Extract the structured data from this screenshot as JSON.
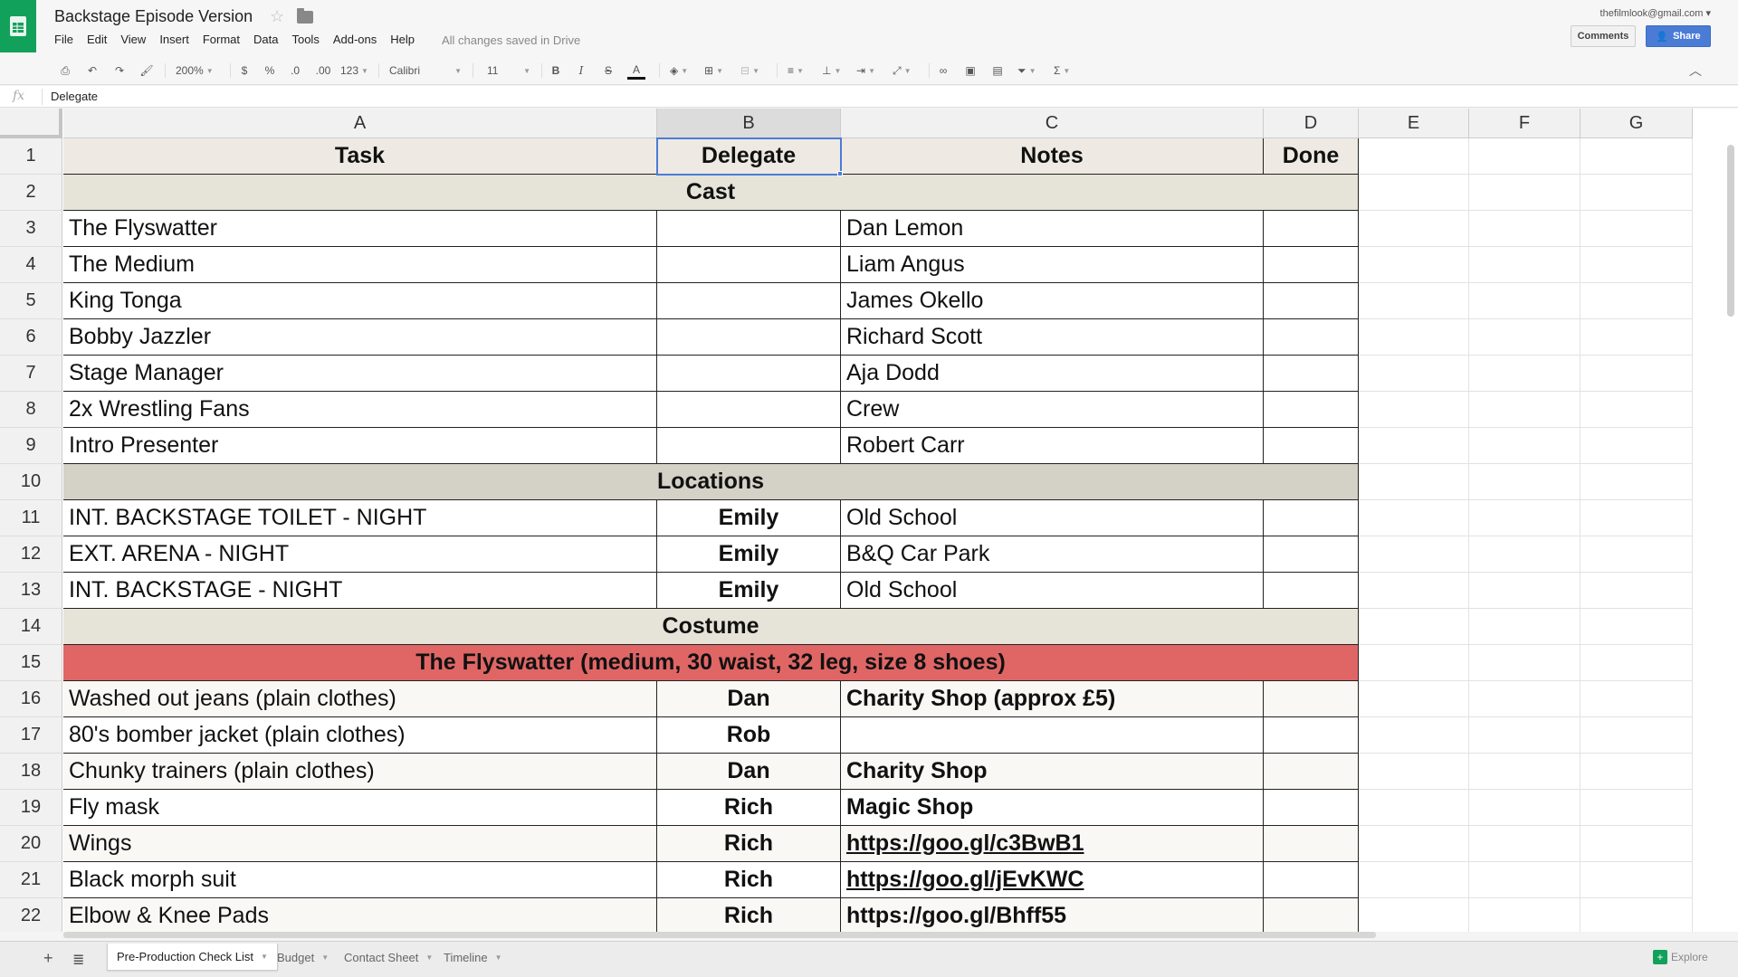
{
  "app": {
    "title": "Backstage Episode Version",
    "account": "thefilmlook@gmail.com",
    "saved_status": "All changes saved in Drive",
    "comments_label": "Comments",
    "share_label": "Share",
    "brand_color": "#12a15a",
    "accent_color": "#4a7cd6"
  },
  "menu": [
    "File",
    "Edit",
    "View",
    "Insert",
    "Format",
    "Data",
    "Tools",
    "Add-ons",
    "Help"
  ],
  "toolbar": {
    "zoom": "200%",
    "currency": "$",
    "percent": "%",
    "decrease_decimal": ".0",
    "increase_decimal": ".00",
    "number_format": "123",
    "font": "Calibri",
    "font_size": "11",
    "bold": "B",
    "italic": "I",
    "strike": "S",
    "text_color": "A",
    "icons": [
      "print-icon",
      "undo-icon",
      "redo-icon",
      "paint-format-icon",
      "fill-color-icon",
      "borders-icon",
      "merge-icon",
      "align-left-icon",
      "valign-icon",
      "wrap-icon",
      "rotate-icon",
      "link-icon",
      "comment-icon",
      "chart-icon",
      "filter-icon",
      "sigma-icon"
    ]
  },
  "formula": {
    "value": "Delegate"
  },
  "columns": [
    "A",
    "B",
    "C",
    "D",
    "E",
    "F",
    "G"
  ],
  "rows": [
    {
      "n": "1",
      "type": "header",
      "a": "Task",
      "b": "Delegate",
      "c": "Notes",
      "d": "Done"
    },
    {
      "n": "2",
      "type": "section",
      "label": "Cast"
    },
    {
      "n": "3",
      "type": "data",
      "a": "The Flyswatter",
      "b": "",
      "c": "Dan Lemon",
      "d": ""
    },
    {
      "n": "4",
      "type": "data",
      "a": "The Medium",
      "b": "",
      "c": "Liam Angus",
      "d": ""
    },
    {
      "n": "5",
      "type": "data",
      "a": "King Tonga",
      "b": "",
      "c": "James Okello",
      "d": ""
    },
    {
      "n": "6",
      "type": "data",
      "a": "Bobby Jazzler",
      "b": "",
      "c": "Richard Scott",
      "d": ""
    },
    {
      "n": "7",
      "type": "data",
      "a": "Stage Manager",
      "b": "",
      "c": "Aja Dodd",
      "d": ""
    },
    {
      "n": "8",
      "type": "data",
      "a": "2x Wrestling Fans",
      "b": "",
      "c": "Crew",
      "d": ""
    },
    {
      "n": "9",
      "type": "data",
      "a": "Intro Presenter",
      "b": "",
      "c": "Robert Carr",
      "d": ""
    },
    {
      "n": "10",
      "type": "section",
      "label": "Locations",
      "variant": "loc"
    },
    {
      "n": "11",
      "type": "data",
      "a": "INT. BACKSTAGE TOILET - NIGHT",
      "b": "Emily",
      "c": "Old School",
      "d": ""
    },
    {
      "n": "12",
      "type": "data",
      "a": "EXT. ARENA - NIGHT",
      "b": "Emily",
      "c": "B&Q Car Park",
      "d": ""
    },
    {
      "n": "13",
      "type": "data",
      "a": "INT. BACKSTAGE - NIGHT",
      "b": "Emily",
      "c": "Old School",
      "d": ""
    },
    {
      "n": "14",
      "type": "section",
      "label": "Costume"
    },
    {
      "n": "15",
      "type": "banner",
      "label": "The Flyswatter (medium, 30 waist, 32 leg, size 8 shoes)"
    },
    {
      "n": "16",
      "type": "data",
      "tint": true,
      "a": "Washed out jeans (plain clothes)",
      "b": "Dan",
      "c": "Charity Shop (approx £5)",
      "d": "",
      "cbold": true
    },
    {
      "n": "17",
      "type": "data",
      "a": "80's bomber jacket (plain clothes)",
      "b": "Rob",
      "c": "",
      "d": ""
    },
    {
      "n": "18",
      "type": "data",
      "tint": true,
      "a": "Chunky trainers (plain clothes)",
      "b": "Dan",
      "c": "Charity Shop",
      "d": "",
      "cbold": true
    },
    {
      "n": "19",
      "type": "data",
      "a": "Fly mask",
      "b": "Rich",
      "c": "Magic Shop",
      "d": "",
      "cbold": true
    },
    {
      "n": "20",
      "type": "data",
      "tint": true,
      "a": "Wings",
      "b": "Rich",
      "c": "https://goo.gl/c3BwB1",
      "d": "",
      "cbold": true,
      "clink": true
    },
    {
      "n": "21",
      "type": "data",
      "a": "Black morph suit",
      "b": "Rich",
      "c": "https://goo.gl/jEvKWC",
      "d": "",
      "cbold": true,
      "clink": true
    },
    {
      "n": "22",
      "type": "data",
      "tint": true,
      "a": "Elbow & Knee Pads",
      "b": "Rich",
      "c": "https://goo.gl/Bhff55",
      "d": "",
      "cbold": true
    }
  ],
  "sheets": [
    {
      "label": "Pre-Production Check List",
      "active": true
    },
    {
      "label": "Budget",
      "active": false
    },
    {
      "label": "Contact Sheet",
      "active": false
    },
    {
      "label": "Timeline",
      "active": false
    }
  ],
  "explore_label": "Explore"
}
